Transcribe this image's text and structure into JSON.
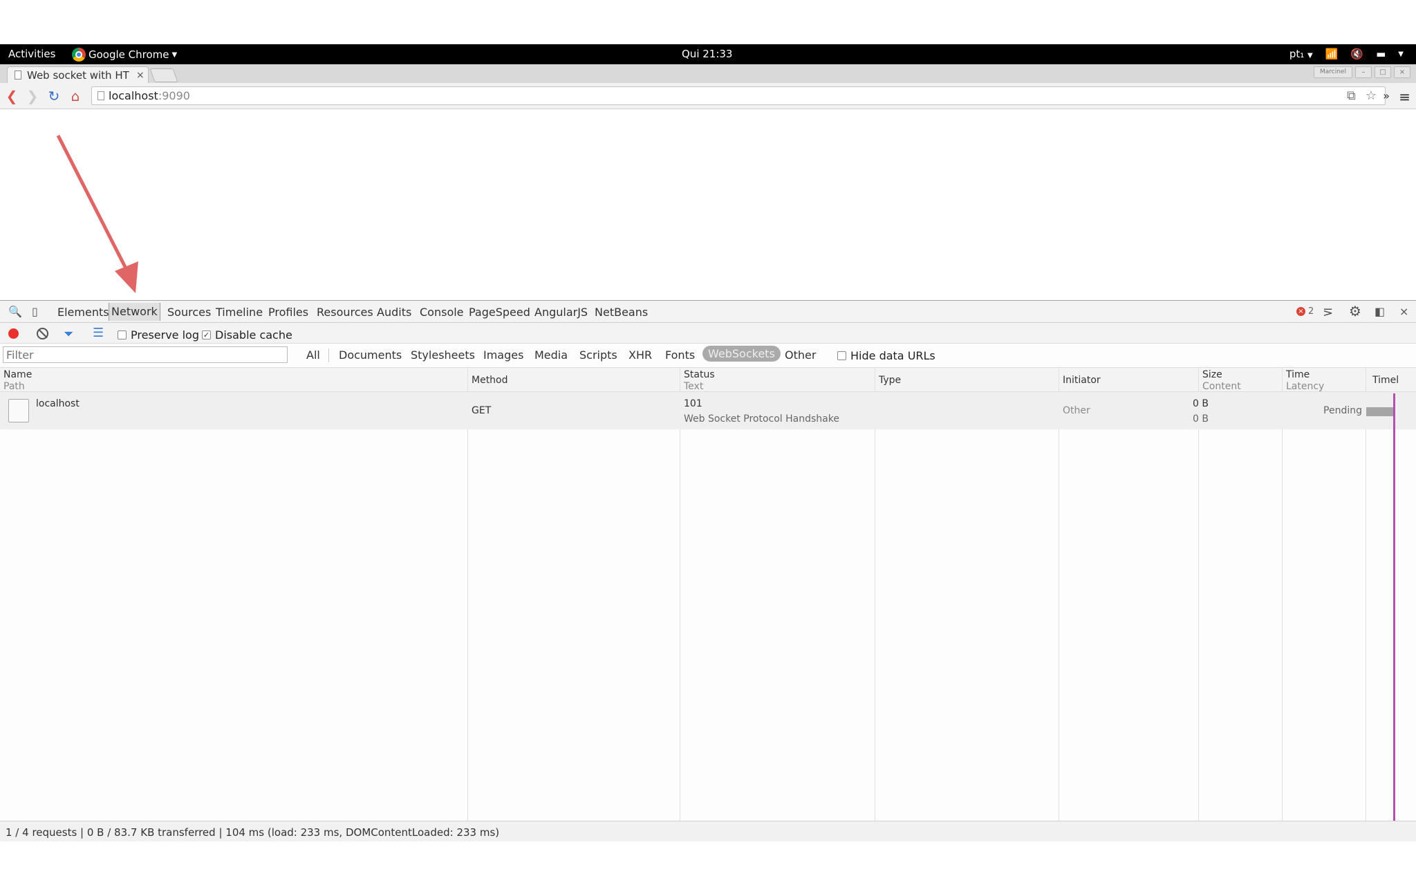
{
  "topbar": {
    "activities": "Activities",
    "app_name": "Google Chrome",
    "clock": "Qui 21:33",
    "lang": "pt₁"
  },
  "browser": {
    "tab_title": "Web socket with HT",
    "tab_close": "×",
    "url_host": "localhost",
    "url_port": ":9090",
    "profile_label": "Marcinel"
  },
  "devtools": {
    "tabs": [
      "Elements",
      "Network",
      "Sources",
      "Timeline",
      "Profiles",
      "Resources",
      "Audits",
      "Console",
      "PageSpeed",
      "AngularJS",
      "NetBeans"
    ],
    "active_tab": "Network",
    "error_count": "2",
    "network": {
      "preserve_log": {
        "label": "Preserve log",
        "checked": false
      },
      "disable_cache": {
        "label": "Disable cache",
        "checked": true
      },
      "filter_placeholder": "Filter",
      "filter_types": [
        "All",
        "Documents",
        "Stylesheets",
        "Images",
        "Media",
        "Scripts",
        "XHR",
        "Fonts",
        "WebSockets",
        "Other"
      ],
      "selected_type": "WebSockets",
      "hide_data_urls": {
        "label": "Hide data URLs",
        "checked": false
      },
      "columns": {
        "name": "Name",
        "name_sub": "Path",
        "method": "Method",
        "status": "Status",
        "status_sub": "Text",
        "type": "Type",
        "initiator": "Initiator",
        "size": "Size",
        "size_sub": "Content",
        "time": "Time",
        "time_sub": "Latency",
        "timeline": "Timel"
      },
      "rows": [
        {
          "name": "localhost",
          "method": "GET",
          "status": "101",
          "status_text": "Web Socket Protocol Handshake",
          "type": "",
          "initiator": "Other",
          "size": "0 B",
          "content": "0 B",
          "time": "Pending"
        }
      ],
      "status_bar": "1 / 4 requests  |  0 B / 83.7 KB transferred  |  104 ms (load: 233 ms, DOMContentLoaded: 233 ms)"
    }
  },
  "colors": {
    "record": "#e8322c",
    "annotation_arrow": "#e06666",
    "timeline_marker": "#b44fb2"
  }
}
